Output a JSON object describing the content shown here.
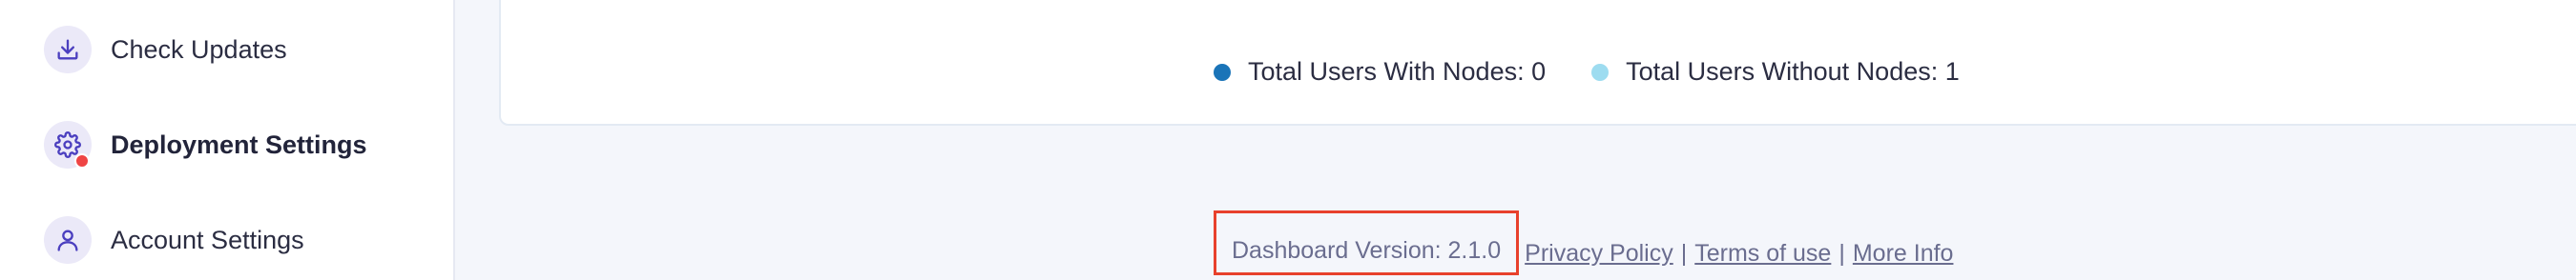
{
  "sidebar": {
    "items": [
      {
        "label": "Check Updates",
        "icon": "download-icon",
        "active": false
      },
      {
        "label": "Deployment Settings",
        "icon": "gear-icon",
        "active": true,
        "notification": true
      },
      {
        "label": "Account Settings",
        "icon": "user-icon",
        "active": false
      }
    ]
  },
  "legend": {
    "items": [
      {
        "label": "Total Users With Nodes: 0",
        "color": "#1a74b8"
      },
      {
        "label": "Total Users Without Nodes: 1",
        "color": "#9ddcf0"
      }
    ]
  },
  "footer": {
    "version": "Dashboard Version: 2.1.0",
    "links": [
      "Privacy Policy",
      "Terms of use",
      "More Info"
    ],
    "separator": "|"
  },
  "colors": {
    "accent": "#4b3fbf",
    "icon_bg": "#ebe9f8",
    "notification": "#ef4444",
    "highlight_box": "#e8412c"
  }
}
